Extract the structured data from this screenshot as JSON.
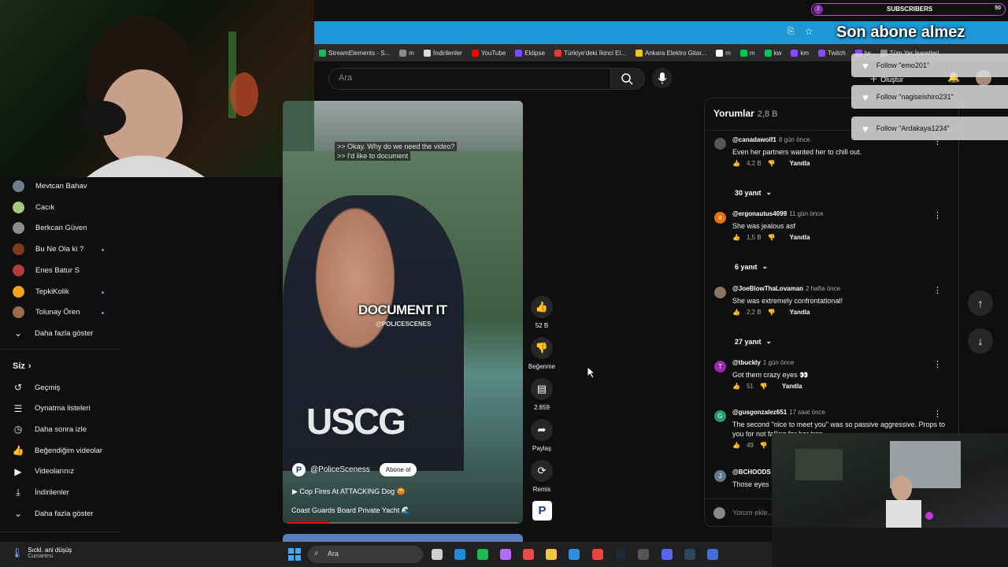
{
  "browser": {
    "bookmarks": [
      {
        "label": "StreamElements - S...",
        "color": "#1db954"
      },
      {
        "label": "m",
        "color": "#8a8a8a"
      },
      {
        "label": "İndirilenler",
        "color": "#dcdcdc"
      },
      {
        "label": "YouTube",
        "color": "#ff0000"
      },
      {
        "label": "Eklipse",
        "color": "#7c4dff"
      },
      {
        "label": "Türkiye'deki İkinci El...",
        "color": "#e53935"
      },
      {
        "label": "Ankara Elektro Gitar...",
        "color": "#f9c80e"
      },
      {
        "label": "m",
        "color": "#ffffff"
      },
      {
        "label": "m",
        "color": "#00c853"
      },
      {
        "label": "kw",
        "color": "#00c853"
      },
      {
        "label": "km",
        "color": "#9146ff"
      },
      {
        "label": "Twitch",
        "color": "#9146ff"
      },
      {
        "label": "tw",
        "color": "#9146ff"
      },
      {
        "label": "Tüm Yer İşaretleri",
        "color": "#8a8a8a"
      }
    ]
  },
  "youtube": {
    "search_placeholder": "Ara",
    "create_label": "Oluştur"
  },
  "sidebar": {
    "subscriptions": [
      {
        "name": "Mevtcan Bahav",
        "color": "#6d7f8a",
        "dot": false
      },
      {
        "name": "Cacık",
        "color": "#a7c97e",
        "dot": false
      },
      {
        "name": "Berkcan Güven",
        "color": "#8d8d8d",
        "dot": false
      },
      {
        "name": "Bu Ne Ola ki ?",
        "color": "#7a3b1f",
        "dot": true
      },
      {
        "name": "Enes Batur S",
        "color": "#b23b3b",
        "dot": false
      },
      {
        "name": "TepkiKolik",
        "color": "#f2a51a",
        "dot": true
      },
      {
        "name": "Tolunay Ören",
        "color": "#9c6b4d",
        "dot": true
      }
    ],
    "show_more": "Daha fazla göster",
    "you_section": "Siz",
    "you_items": [
      {
        "label": "Geçmiş",
        "icon": "history-icon",
        "glyph": "↺"
      },
      {
        "label": "Oynatma listeleri",
        "icon": "playlist-icon",
        "glyph": "☰"
      },
      {
        "label": "Daha sonra izle",
        "icon": "clock-icon",
        "glyph": "◷"
      },
      {
        "label": "Beğendiğim videolar",
        "icon": "thumbs-up-icon",
        "glyph": "👍"
      },
      {
        "label": "Videolarınız",
        "icon": "video-icon",
        "glyph": "▶"
      },
      {
        "label": "İndirilenler",
        "icon": "download-icon",
        "glyph": "⤓"
      }
    ],
    "show_more_2": "Daha fazla göster"
  },
  "video": {
    "caption_1": ">> Okay. Why do we need the video?",
    "caption_2": ">> I'd like to document",
    "overlay_text": "DOCUMENT IT",
    "watermark": "@POLICESCENES",
    "vest_text": "USCG",
    "channel_logo": "P",
    "channel": "@PoliceSceness",
    "subscribe": "Abone ol",
    "title": "▶ Cop Fires At ATTACKING Dog 😡",
    "subtitle": "Coast Guards Board Private Yacht 🌊",
    "progress": 0.18
  },
  "actions": {
    "likes": "52 B",
    "dislike": "Beğenme",
    "comments": "2.859",
    "share": "Paylaş",
    "remix": "Remix"
  },
  "comments": {
    "header": "Yorumlar",
    "count": "2,8 B",
    "items": [
      {
        "user": "@canadawolf1",
        "time": "8 gün önce",
        "text": "Even her partners wanted her to chill out.",
        "likes": "4,2 B",
        "avatar_color": "#555",
        "initial": "",
        "replies": "30 yanıt"
      },
      {
        "user": "@ergonautus4099",
        "time": "11 gün önce",
        "text": "She was jealous asf",
        "likes": "1,5 B",
        "avatar_color": "#e8710a",
        "initial": "e",
        "replies": "6 yanıt"
      },
      {
        "user": "@JoeBlowThaLovaman",
        "time": "2 hafta önce",
        "text": "She was extremely confrontational!",
        "likes": "2,2 B",
        "avatar_color": "#8a7560",
        "initial": "",
        "replies": "27 yanıt"
      },
      {
        "user": "@tbuckly",
        "time": "1 gün önce",
        "text": "Got them crazy eyes 👀",
        "likes": "51",
        "avatar_color": "#9c27b0",
        "initial": "T",
        "replies": ""
      },
      {
        "user": "@gusgonzalez651",
        "time": "17 saat önce",
        "text": "The second \"nice to meet you\" was so passive aggressive. Props to you for not falling for her trap.",
        "likes": "49",
        "avatar_color": "#1e9e6a",
        "initial": "G",
        "replies": ""
      },
      {
        "user": "@BCHOODS",
        "time": "",
        "text": "Those eyes",
        "likes": "",
        "avatar_color": "#607d8b",
        "initial": "J",
        "replies": ""
      }
    ],
    "reply_label": "Yanıtla",
    "add_placeholder": "Yorum ekle..."
  },
  "overlay": {
    "subscribers_label": "SUBSCRIBERS",
    "subscribers_num": "2",
    "subscribers_val": "50",
    "goal_text": "Son abone almez",
    "follows": [
      "Follow \"emo201\"",
      "Follow \"nagiseishiro231\"",
      "Follow \"Ardakaya1234\""
    ]
  },
  "taskbar": {
    "weather_title": "Sıckl. ani düşüş",
    "weather_day": "Cumartesi",
    "search": "Ara"
  }
}
